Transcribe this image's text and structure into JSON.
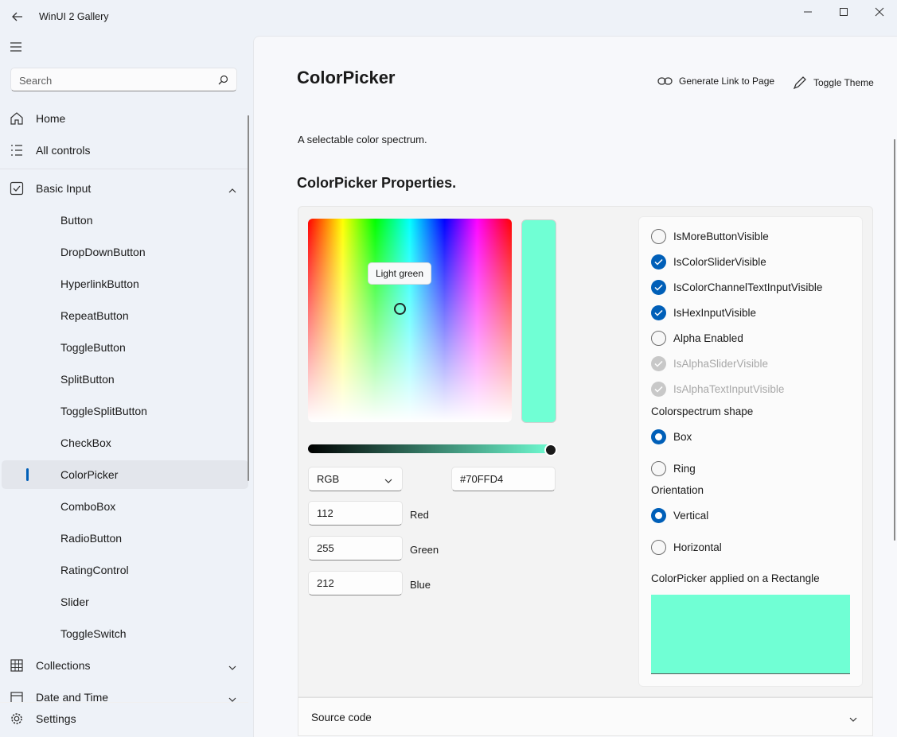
{
  "app": {
    "title": "WinUI 2 Gallery"
  },
  "search": {
    "placeholder": "Search"
  },
  "nav": {
    "home": "Home",
    "all_controls": "All controls",
    "basic_input": "Basic Input",
    "sub_items": [
      "Button",
      "DropDownButton",
      "HyperlinkButton",
      "RepeatButton",
      "ToggleButton",
      "SplitButton",
      "ToggleSplitButton",
      "CheckBox",
      "ColorPicker",
      "ComboBox",
      "RadioButton",
      "RatingControl",
      "Slider",
      "ToggleSwitch"
    ],
    "selected": "ColorPicker",
    "collections": "Collections",
    "date_time": "Date and Time",
    "settings": "Settings"
  },
  "page": {
    "title": "ColorPicker",
    "generate_link": "Generate Link to Page",
    "toggle_theme": "Toggle Theme",
    "description": "A selectable color spectrum.",
    "section": "ColorPicker Properties."
  },
  "picker": {
    "tooltip": "Light green",
    "color": "#70FFD4",
    "mode": "RGB",
    "hex": "#70FFD4",
    "red": "112",
    "red_label": "Red",
    "green": "255",
    "green_label": "Green",
    "blue": "212",
    "blue_label": "Blue"
  },
  "options": {
    "checkboxes": [
      {
        "label": "IsMoreButtonVisible",
        "checked": false,
        "disabled": false
      },
      {
        "label": "IsColorSliderVisible",
        "checked": true,
        "disabled": false
      },
      {
        "label": "IsColorChannelTextInputVisible",
        "checked": true,
        "disabled": false
      },
      {
        "label": "IsHexInputVisible",
        "checked": true,
        "disabled": false
      },
      {
        "label": "Alpha Enabled",
        "checked": false,
        "disabled": false
      },
      {
        "label": "IsAlphaSliderVisible",
        "checked": true,
        "disabled": true
      },
      {
        "label": "IsAlphaTextInputVisible",
        "checked": true,
        "disabled": true
      }
    ],
    "shape_header": "Colorspectrum shape",
    "shape_box": "Box",
    "shape_ring": "Ring",
    "orientation_header": "Orientation",
    "orientation_vertical": "Vertical",
    "orientation_horizontal": "Horizontal",
    "rect_label": "ColorPicker applied on a Rectangle"
  },
  "source": {
    "label": "Source code"
  }
}
